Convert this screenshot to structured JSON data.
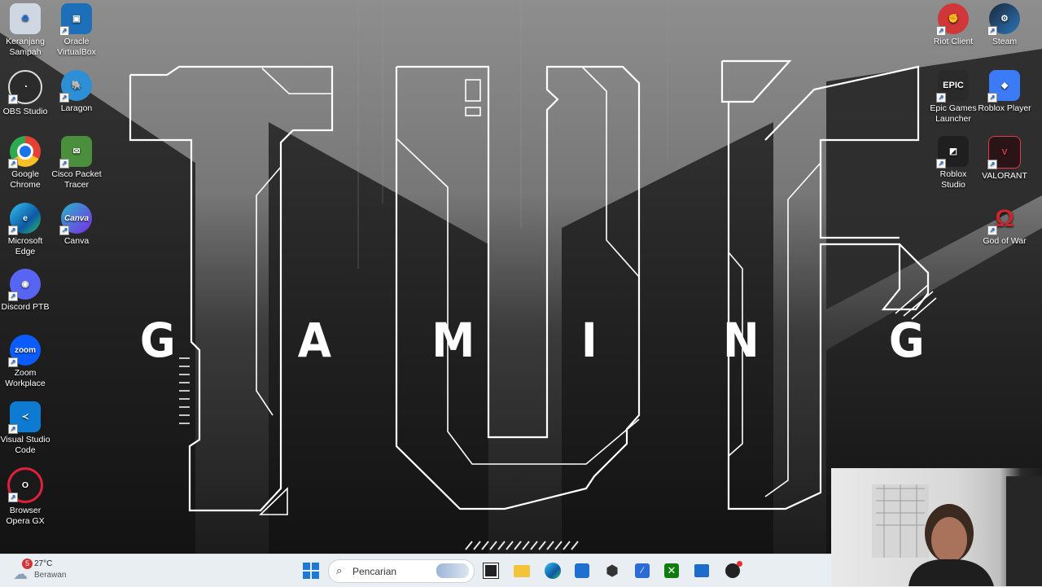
{
  "wallpaper": {
    "brand_letters": [
      "G",
      "A",
      "M",
      "I",
      "N",
      "G"
    ]
  },
  "desktop_icons": [
    {
      "label": "Keranjang\nSampah",
      "icon": "recycle-bin-icon",
      "color": "#b8c7d6"
    },
    {
      "label": "Oracle\nVirtualBox",
      "icon": "virtualbox-icon",
      "color": "#1c6fb8"
    },
    {
      "label": "OBS Studio",
      "icon": "obs-icon",
      "color": "#2b2b2b"
    },
    {
      "label": "Laragon",
      "icon": "laragon-icon",
      "color": "#2d8fd6"
    },
    {
      "label": "Google\nChrome",
      "icon": "chrome-icon",
      "color": "#e34133"
    },
    {
      "label": "Cisco Packet\nTracer",
      "icon": "cisco-packet-tracer-icon",
      "color": "#4a8f3c"
    },
    {
      "label": "Microsoft\nEdge",
      "icon": "edge-icon",
      "color": "#1aa0d8"
    },
    {
      "label": "Canva",
      "icon": "canva-icon",
      "color": "#27b6c9"
    },
    {
      "label": "Discord PTB",
      "icon": "discord-icon",
      "color": "#5865f2"
    },
    {
      "label": "Zoom\nWorkplace",
      "icon": "zoom-icon",
      "color": "#0b5cff"
    },
    {
      "label": "Visual Studio\nCode",
      "icon": "vscode-icon",
      "color": "#0d7bd1"
    },
    {
      "label": "Browser\nOpera GX",
      "icon": "opera-gx-icon",
      "color": "#e0213b"
    },
    {
      "label": "Riot Client",
      "icon": "riot-client-icon",
      "color": "#d13639"
    },
    {
      "label": "Steam",
      "icon": "steam-icon",
      "color": "#1b2838"
    },
    {
      "label": "Epic Games\nLauncher",
      "icon": "epic-games-icon",
      "color": "#2a2a2a"
    },
    {
      "label": "Roblox Player",
      "icon": "roblox-icon",
      "color": "#3b7cf6"
    },
    {
      "label": "Roblox\nStudio",
      "icon": "roblox-studio-icon",
      "color": "#1f1f1f"
    },
    {
      "label": "VALORANT",
      "icon": "valorant-icon",
      "color": "#e23a4c"
    },
    {
      "label": "God of War",
      "icon": "god-of-war-icon",
      "color": "#c4282c"
    }
  ],
  "taskbar": {
    "weather": {
      "temp": "27°C",
      "condition": "Berawan",
      "badge": "5"
    },
    "search_placeholder": "Pencarian",
    "apps": [
      {
        "name": "start-button",
        "icon": "windows-logo-icon",
        "color": "#1e78d6"
      },
      {
        "name": "task-view",
        "icon": "task-view-icon",
        "color": "#222"
      },
      {
        "name": "file-explorer",
        "icon": "folder-icon",
        "color": "#f3c33a"
      },
      {
        "name": "edge",
        "icon": "edge-icon",
        "color": "#1aa0d8"
      },
      {
        "name": "microsoft-store",
        "icon": "store-icon",
        "color": "#1f6fd1"
      },
      {
        "name": "unity-hub",
        "icon": "unity-icon",
        "color": "#333"
      },
      {
        "name": "azure-data-studio",
        "icon": "azure-icon",
        "color": "#2b6bd6"
      },
      {
        "name": "xbox",
        "icon": "xbox-icon",
        "color": "#107c10"
      },
      {
        "name": "outlook",
        "icon": "outlook-icon",
        "color": "#1b6ccd"
      },
      {
        "name": "obs-studio",
        "icon": "obs-icon",
        "color": "#222"
      }
    ]
  }
}
